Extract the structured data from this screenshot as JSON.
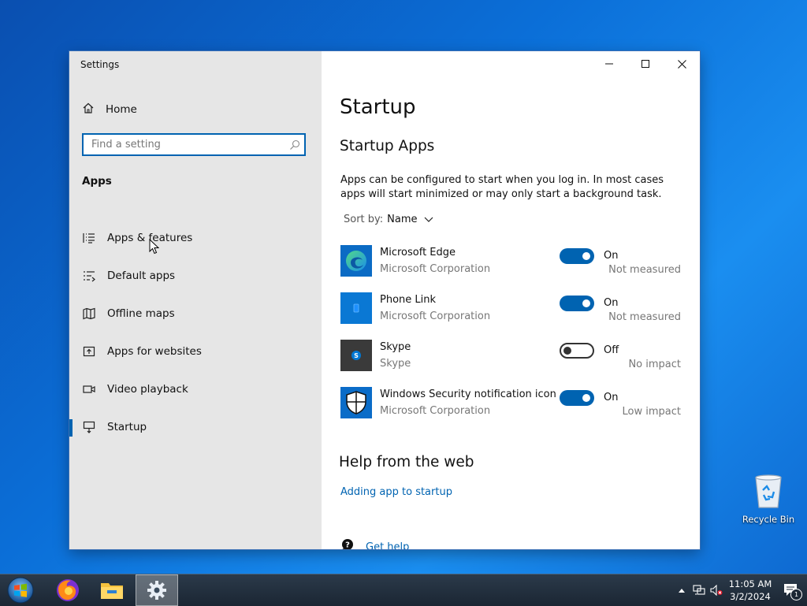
{
  "window": {
    "title": "Settings"
  },
  "sidebar": {
    "home_label": "Home",
    "search_placeholder": "Find a setting",
    "section_title": "Apps",
    "items": [
      {
        "label": "Apps & features",
        "icon": "list-icon"
      },
      {
        "label": "Default apps",
        "icon": "default-apps-icon"
      },
      {
        "label": "Offline maps",
        "icon": "map-icon"
      },
      {
        "label": "Apps for websites",
        "icon": "external-window-icon"
      },
      {
        "label": "Video playback",
        "icon": "video-icon"
      },
      {
        "label": "Startup",
        "icon": "startup-icon",
        "active": true
      }
    ]
  },
  "main": {
    "title": "Startup",
    "subtitle": "Startup Apps",
    "description": "Apps can be configured to start when you log in. In most cases apps will start minimized or may only start a background task.",
    "sort_label": "Sort by:",
    "sort_value": "Name",
    "apps": [
      {
        "name": "Microsoft Edge",
        "publisher": "Microsoft Corporation",
        "state": "On",
        "enabled": true,
        "impact": "Not measured",
        "icon": "edge-icon"
      },
      {
        "name": "Phone Link",
        "publisher": "Microsoft Corporation",
        "state": "On",
        "enabled": true,
        "impact": "Not measured",
        "icon": "phone-link-icon"
      },
      {
        "name": "Skype",
        "publisher": "Skype",
        "state": "Off",
        "enabled": false,
        "impact": "No impact",
        "icon": "skype-icon"
      },
      {
        "name": "Windows Security notification icon",
        "publisher": "Microsoft Corporation",
        "state": "On",
        "enabled": true,
        "impact": "Low impact",
        "icon": "shield-icon"
      }
    ],
    "help_title": "Help from the web",
    "help_link": "Adding app to startup",
    "get_help": "Get help"
  },
  "desktop": {
    "recycle_bin_label": "Recycle Bin"
  },
  "taskbar": {
    "time": "11:05 AM",
    "date": "3/2/2024",
    "notification_count": "1"
  },
  "colors": {
    "accent": "#0063b1",
    "sidebar_bg": "#e6e6e6",
    "link": "#0063b1"
  }
}
